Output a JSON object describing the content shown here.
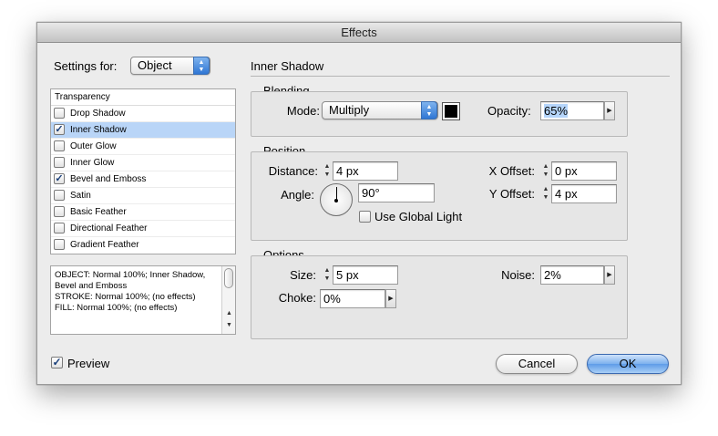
{
  "window": {
    "title": "Effects"
  },
  "settings_for": {
    "label": "Settings for:",
    "value": "Object"
  },
  "effects_list": {
    "header": "Transparency",
    "items": [
      {
        "label": "Drop Shadow",
        "checked": false,
        "selected": false
      },
      {
        "label": "Inner Shadow",
        "checked": true,
        "selected": true
      },
      {
        "label": "Outer Glow",
        "checked": false,
        "selected": false
      },
      {
        "label": "Inner Glow",
        "checked": false,
        "selected": false
      },
      {
        "label": "Bevel and Emboss",
        "checked": true,
        "selected": false
      },
      {
        "label": "Satin",
        "checked": false,
        "selected": false
      },
      {
        "label": "Basic Feather",
        "checked": false,
        "selected": false
      },
      {
        "label": "Directional Feather",
        "checked": false,
        "selected": false
      },
      {
        "label": "Gradient Feather",
        "checked": false,
        "selected": false
      }
    ]
  },
  "summary": {
    "lines": [
      "OBJECT: Normal 100%; Inner Shadow, Bevel and Emboss",
      "STROKE: Normal 100%; (no effects)",
      "FILL: Normal 100%; (no effects)"
    ]
  },
  "panel": {
    "title": "Inner Shadow"
  },
  "blending": {
    "title": "Blending",
    "mode_label": "Mode:",
    "mode_value": "Multiply",
    "color": "#000000",
    "opacity_label": "Opacity:",
    "opacity_value": "65%"
  },
  "position": {
    "title": "Position",
    "distance_label": "Distance:",
    "distance_value": "4 px",
    "angle_label": "Angle:",
    "angle_value": "90°",
    "global_light_label": "Use Global Light",
    "global_light_checked": false,
    "x_offset_label": "X Offset:",
    "x_offset_value": "0 px",
    "y_offset_label": "Y Offset:",
    "y_offset_value": "4 px"
  },
  "options": {
    "title": "Options",
    "size_label": "Size:",
    "size_value": "5 px",
    "noise_label": "Noise:",
    "noise_value": "2%",
    "choke_label": "Choke:",
    "choke_value": "0%"
  },
  "footer": {
    "preview_label": "Preview",
    "preview_checked": true,
    "cancel_label": "Cancel",
    "ok_label": "OK"
  }
}
